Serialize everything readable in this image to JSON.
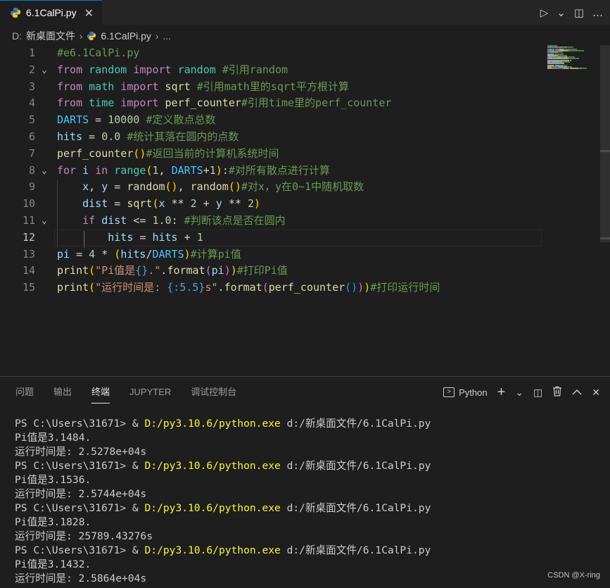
{
  "tab": {
    "filename": "6.1CalPi.py",
    "close": "✕"
  },
  "toolbar": {
    "run": "▷",
    "run_menu": "⌄",
    "split": "◫",
    "more": "…"
  },
  "breadcrumb": {
    "drive": "D:",
    "folder": "新桌面文件",
    "file": "6.1CalPi.py",
    "more": "..."
  },
  "editor": {
    "current_line": 12,
    "lines": [
      {
        "n": "1",
        "fold": ""
      },
      {
        "n": "2",
        "fold": "⌄"
      },
      {
        "n": "3",
        "fold": ""
      },
      {
        "n": "4",
        "fold": ""
      },
      {
        "n": "5",
        "fold": ""
      },
      {
        "n": "6",
        "fold": ""
      },
      {
        "n": "7",
        "fold": ""
      },
      {
        "n": "8",
        "fold": "⌄"
      },
      {
        "n": "9",
        "fold": ""
      },
      {
        "n": "10",
        "fold": ""
      },
      {
        "n": "11",
        "fold": "⌄"
      },
      {
        "n": "12",
        "fold": ""
      },
      {
        "n": "13",
        "fold": ""
      },
      {
        "n": "14",
        "fold": ""
      },
      {
        "n": "15",
        "fold": ""
      }
    ],
    "code": [
      [
        [
          "c-com",
          "#e6.1CalPi.py"
        ]
      ],
      [
        [
          "c-kw",
          "from"
        ],
        [
          "c-op",
          " "
        ],
        [
          "c-bi",
          "random"
        ],
        [
          "c-op",
          " "
        ],
        [
          "c-kw",
          "import"
        ],
        [
          "c-op",
          " "
        ],
        [
          "c-bi",
          "random"
        ],
        [
          "c-op",
          " "
        ],
        [
          "c-com",
          "#引用random"
        ]
      ],
      [
        [
          "c-kw",
          "from"
        ],
        [
          "c-op",
          " "
        ],
        [
          "c-bi",
          "math"
        ],
        [
          "c-op",
          " "
        ],
        [
          "c-kw",
          "import"
        ],
        [
          "c-op",
          " "
        ],
        [
          "c-fn",
          "sqrt"
        ],
        [
          "c-op",
          " "
        ],
        [
          "c-com",
          "#引用math里的sqrt平方根计算"
        ]
      ],
      [
        [
          "c-kw",
          "from"
        ],
        [
          "c-op",
          " "
        ],
        [
          "c-bi",
          "time"
        ],
        [
          "c-op",
          " "
        ],
        [
          "c-kw",
          "import"
        ],
        [
          "c-op",
          " "
        ],
        [
          "c-fn",
          "perf_counter"
        ],
        [
          "c-com",
          "#引用time里的perf_counter"
        ]
      ],
      [
        [
          "c-const",
          "DARTS"
        ],
        [
          "c-op",
          " = "
        ],
        [
          "c-num",
          "10000"
        ],
        [
          "c-op",
          " "
        ],
        [
          "c-com",
          "#定义散点总数"
        ]
      ],
      [
        [
          "c-var",
          "hits"
        ],
        [
          "c-op",
          " = "
        ],
        [
          "c-num",
          "0.0"
        ],
        [
          "c-op",
          " "
        ],
        [
          "c-com",
          "#统计其落在圆内的点数"
        ]
      ],
      [
        [
          "c-fn",
          "perf_counter"
        ],
        [
          "c-p1",
          "()"
        ],
        [
          "c-com",
          "#返回当前的计算机系统时间"
        ]
      ],
      [
        [
          "c-ctrl",
          "for"
        ],
        [
          "c-op",
          " "
        ],
        [
          "c-var",
          "i"
        ],
        [
          "c-op",
          " "
        ],
        [
          "c-ctrl",
          "in"
        ],
        [
          "c-op",
          " "
        ],
        [
          "c-bi",
          "range"
        ],
        [
          "c-p1",
          "("
        ],
        [
          "c-num",
          "1"
        ],
        [
          "c-op",
          ", "
        ],
        [
          "c-const",
          "DARTS"
        ],
        [
          "c-op",
          "+"
        ],
        [
          "c-num",
          "1"
        ],
        [
          "c-p1",
          ")"
        ],
        [
          "c-op",
          ":"
        ],
        [
          "c-com",
          "#对所有散点进行计算"
        ]
      ],
      [
        [
          "c-op",
          "    "
        ],
        [
          "c-var",
          "x"
        ],
        [
          "c-op",
          ", "
        ],
        [
          "c-var",
          "y"
        ],
        [
          "c-op",
          " = "
        ],
        [
          "c-fn",
          "random"
        ],
        [
          "c-p1",
          "()"
        ],
        [
          "c-op",
          ", "
        ],
        [
          "c-fn",
          "random"
        ],
        [
          "c-p1",
          "()"
        ],
        [
          "c-com",
          "#对x，y在0~1中随机取数"
        ]
      ],
      [
        [
          "c-op",
          "    "
        ],
        [
          "c-var",
          "dist"
        ],
        [
          "c-op",
          " = "
        ],
        [
          "c-fn",
          "sqrt"
        ],
        [
          "c-p1",
          "("
        ],
        [
          "c-var",
          "x"
        ],
        [
          "c-op",
          " ** "
        ],
        [
          "c-num",
          "2"
        ],
        [
          "c-op",
          " + "
        ],
        [
          "c-var",
          "y"
        ],
        [
          "c-op",
          " ** "
        ],
        [
          "c-num",
          "2"
        ],
        [
          "c-p1",
          ")"
        ]
      ],
      [
        [
          "c-op",
          "    "
        ],
        [
          "c-ctrl",
          "if"
        ],
        [
          "c-op",
          " "
        ],
        [
          "c-var",
          "dist"
        ],
        [
          "c-op",
          " <= "
        ],
        [
          "c-num",
          "1.0"
        ],
        [
          "c-op",
          ": "
        ],
        [
          "c-com",
          "#判断该点是否在圆内"
        ]
      ],
      [
        [
          "c-op",
          "        "
        ],
        [
          "c-var",
          "hits"
        ],
        [
          "c-op",
          " = "
        ],
        [
          "c-var",
          "hits"
        ],
        [
          "c-op",
          " + "
        ],
        [
          "c-num",
          "1"
        ]
      ],
      [
        [
          "c-var",
          "pi"
        ],
        [
          "c-op",
          " = "
        ],
        [
          "c-num",
          "4"
        ],
        [
          "c-op",
          " * "
        ],
        [
          "c-p1",
          "("
        ],
        [
          "c-var",
          "hits"
        ],
        [
          "c-op",
          "/"
        ],
        [
          "c-const",
          "DARTS"
        ],
        [
          "c-p1",
          ")"
        ],
        [
          "c-com",
          "#计算pi值"
        ]
      ],
      [
        [
          "c-fn",
          "print"
        ],
        [
          "c-p1",
          "("
        ],
        [
          "c-str",
          "\"Pi值是"
        ],
        [
          "c-fmt",
          "{}"
        ],
        [
          "c-str",
          ".\""
        ],
        [
          "c-op",
          "."
        ],
        [
          "c-fn",
          "format"
        ],
        [
          "c-p2",
          "("
        ],
        [
          "c-var",
          "pi"
        ],
        [
          "c-p2",
          ")"
        ],
        [
          "c-p1",
          ")"
        ],
        [
          "c-com",
          "#打印Pi值"
        ]
      ],
      [
        [
          "c-fn",
          "print"
        ],
        [
          "c-p1",
          "("
        ],
        [
          "c-str",
          "\"运行时间是: "
        ],
        [
          "c-fmt",
          "{:5.5}"
        ],
        [
          "c-str",
          "s\""
        ],
        [
          "c-op",
          "."
        ],
        [
          "c-fn",
          "format"
        ],
        [
          "c-p2",
          "("
        ],
        [
          "c-fn",
          "perf_counter"
        ],
        [
          "c-p3",
          "()"
        ],
        [
          "c-p2",
          ")"
        ],
        [
          "c-p1",
          ")"
        ],
        [
          "c-com",
          "#打印运行时间"
        ]
      ]
    ]
  },
  "panel": {
    "tabs": [
      "问题",
      "输出",
      "终端",
      "JUPYTER",
      "调试控制台"
    ],
    "active_tab": "终端",
    "shell_label": "Python",
    "actions": {
      "add": "+",
      "add_menu": "⌄",
      "split": "◫",
      "trash": "🗑",
      "maximize": "︿",
      "close": "✕"
    }
  },
  "terminal": {
    "runs": [
      {
        "prompt": "PS C:\\Users\\31671> & ",
        "exe": "D:/py3.10.6/python.exe",
        "arg": " d:/新桌面文件/6.1CalPi.py",
        "pi": "Pi值是3.1484.",
        "time": "运行时间是: 2.5278e+04s"
      },
      {
        "prompt": "PS C:\\Users\\31671> & ",
        "exe": "D:/py3.10.6/python.exe",
        "arg": " d:/新桌面文件/6.1CalPi.py",
        "pi": "Pi值是3.1536.",
        "time": "运行时间是: 2.5744e+04s"
      },
      {
        "prompt": "PS C:\\Users\\31671> & ",
        "exe": "D:/py3.10.6/python.exe",
        "arg": " d:/新桌面文件/6.1CalPi.py",
        "pi": "Pi值是3.1828.",
        "time": "运行时间是: 25789.43276s"
      },
      {
        "prompt": "PS C:\\Users\\31671> & ",
        "exe": "D:/py3.10.6/python.exe",
        "arg": " d:/新桌面文件/6.1CalPi.py",
        "pi": "Pi值是3.1432.",
        "time": "运行时间是: 2.5864e+04s"
      }
    ]
  },
  "watermark": "CSDN @X-ring"
}
